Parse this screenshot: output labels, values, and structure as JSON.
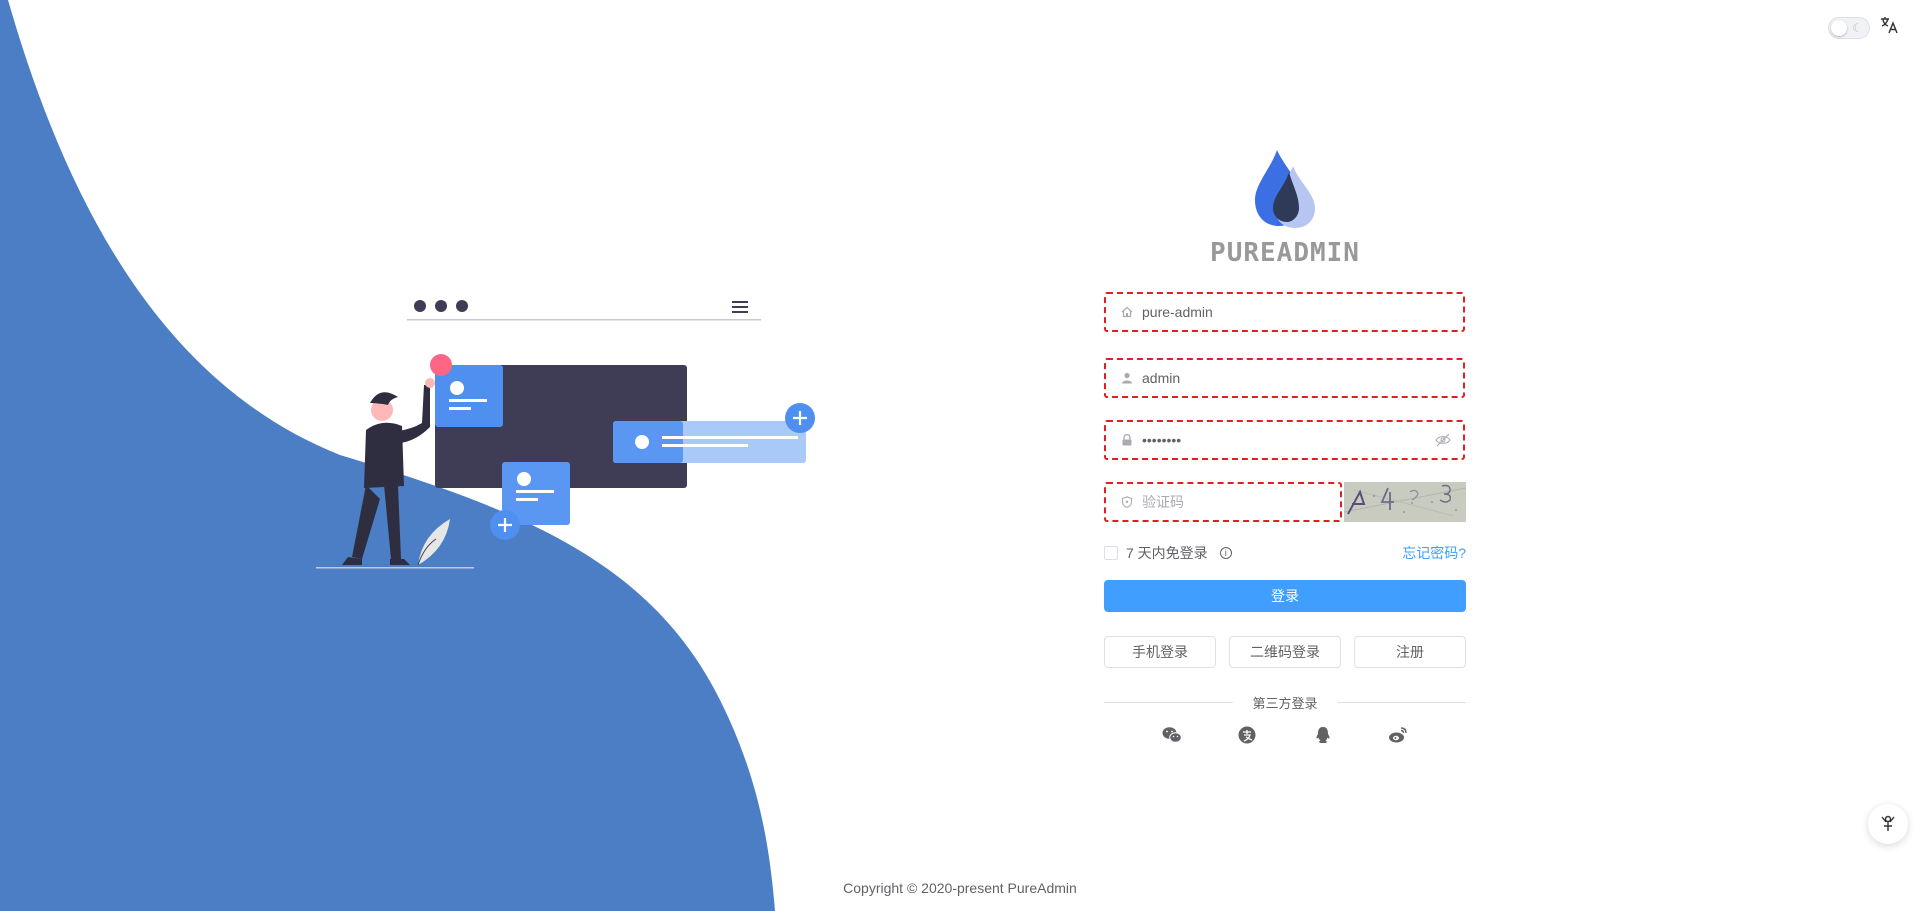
{
  "brand": {
    "name": "PUREADMIN",
    "primary_color": "#409eff",
    "wave_color": "#4b7ec4"
  },
  "topbar": {
    "theme_toggle": "dark-mode-switch",
    "language_icon": "translate-icon"
  },
  "form": {
    "tenant": {
      "value": "pure-admin",
      "icon": "house-icon"
    },
    "username": {
      "value": "admin",
      "icon": "user-icon"
    },
    "password": {
      "value": "••••••••",
      "icon": "lock-icon",
      "toggle_icon": "eye-hidden-icon"
    },
    "captcha": {
      "placeholder": "验证码",
      "icon": "shield-icon",
      "image_text": "4 4 ? 3"
    },
    "remember_label": "7 天内免登录",
    "forgot_label": "忘记密码?",
    "login_button": "登录",
    "alt_logins": [
      "手机登录",
      "二维码登录",
      "注册"
    ],
    "third_party_label": "第三方登录",
    "third_party_icons": [
      "wechat-icon",
      "alipay-icon",
      "qq-icon",
      "weibo-icon"
    ]
  },
  "footer": {
    "copyright": "Copyright © 2020-present PureAdmin"
  }
}
